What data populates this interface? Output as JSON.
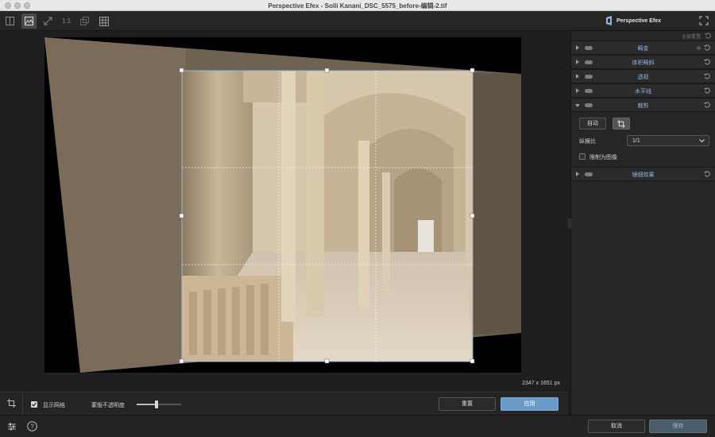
{
  "window": {
    "title": "Perspective Efex - Solli Kanani_DSC_5575_before-编辑-2.tif"
  },
  "brand": {
    "name": "Perspective Efex"
  },
  "toolbar": {
    "one_to_one": "1:1"
  },
  "canvas": {
    "dimensions": "2347 x 1651 px"
  },
  "bottombar": {
    "show_grid_label": "显示网格",
    "show_grid_checked": true,
    "mask_opacity_label": "蒙版不透明度",
    "mask_opacity_value": 0.45,
    "reset_label": "重置",
    "apply_label": "应用"
  },
  "panel": {
    "reset_all_label": "全部重置",
    "sections": [
      {
        "label": "畸变"
      },
      {
        "label": "体积畸斜"
      },
      {
        "label": "透视"
      },
      {
        "label": "水平线"
      },
      {
        "label": "裁剪"
      },
      {
        "label": "镜细效果"
      }
    ],
    "crop": {
      "auto_label": "自动",
      "aspect_label": "纵横比",
      "aspect_value": "1/1",
      "constrain_label": "限制为图像",
      "constrain_checked": false
    }
  },
  "footer": {
    "cancel_label": "取消",
    "save_label": "保存"
  },
  "colors": {
    "accent": "#6b9cc7",
    "section_label": "#8fb6e0",
    "background": "#1e1e1e",
    "panel": "#262626"
  }
}
